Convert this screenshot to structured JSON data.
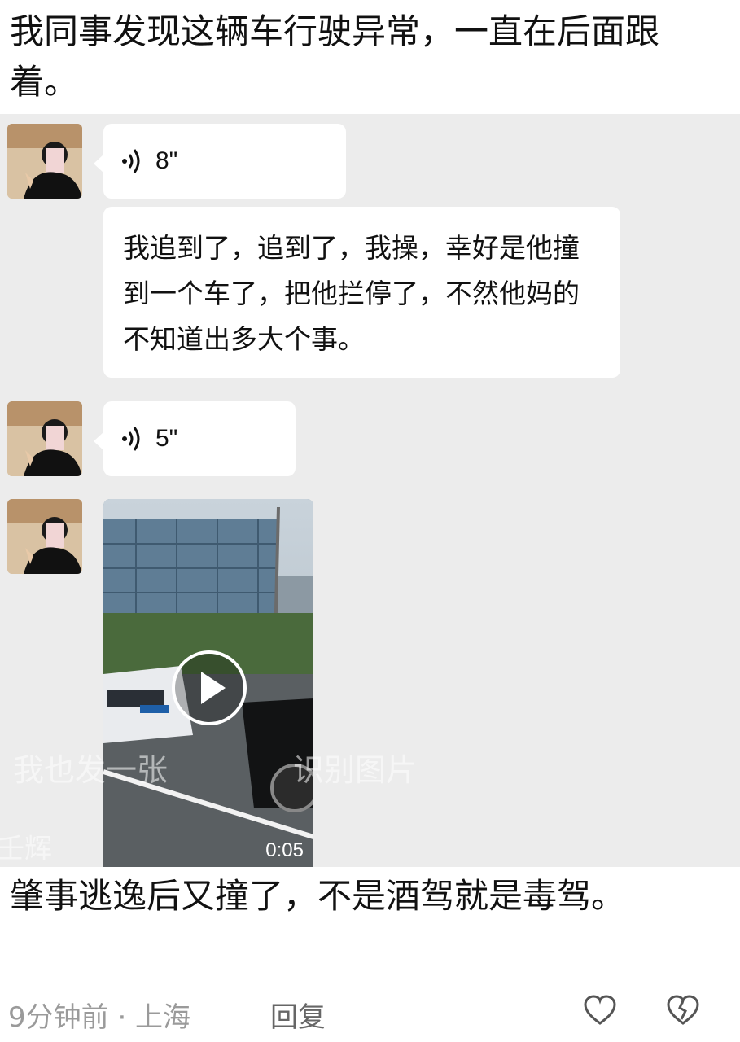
{
  "post": {
    "text": "我同事发现这辆车行驶异常，一直在后面跟着。"
  },
  "chat": {
    "voice_1": {
      "duration": "8\""
    },
    "text_message": "我追到了，追到了，我操，幸好是他撞到一个车了，把他拦停了，不然他妈的不知道出多大个事。",
    "voice_2": {
      "duration": "5\""
    },
    "video": {
      "duration": "0:05",
      "watermark_left": "我也发一张",
      "watermark_right": "识别图片",
      "watermark_bottom": "壬辉"
    }
  },
  "comment": {
    "text": "肇事逃逸后又撞了，不是酒驾就是毒驾。",
    "meta": "9分钟前 · 上海",
    "reply_label": "回复"
  },
  "colors": {
    "chat_bg": "#ececec",
    "meta_gray": "#9a9a9a"
  }
}
